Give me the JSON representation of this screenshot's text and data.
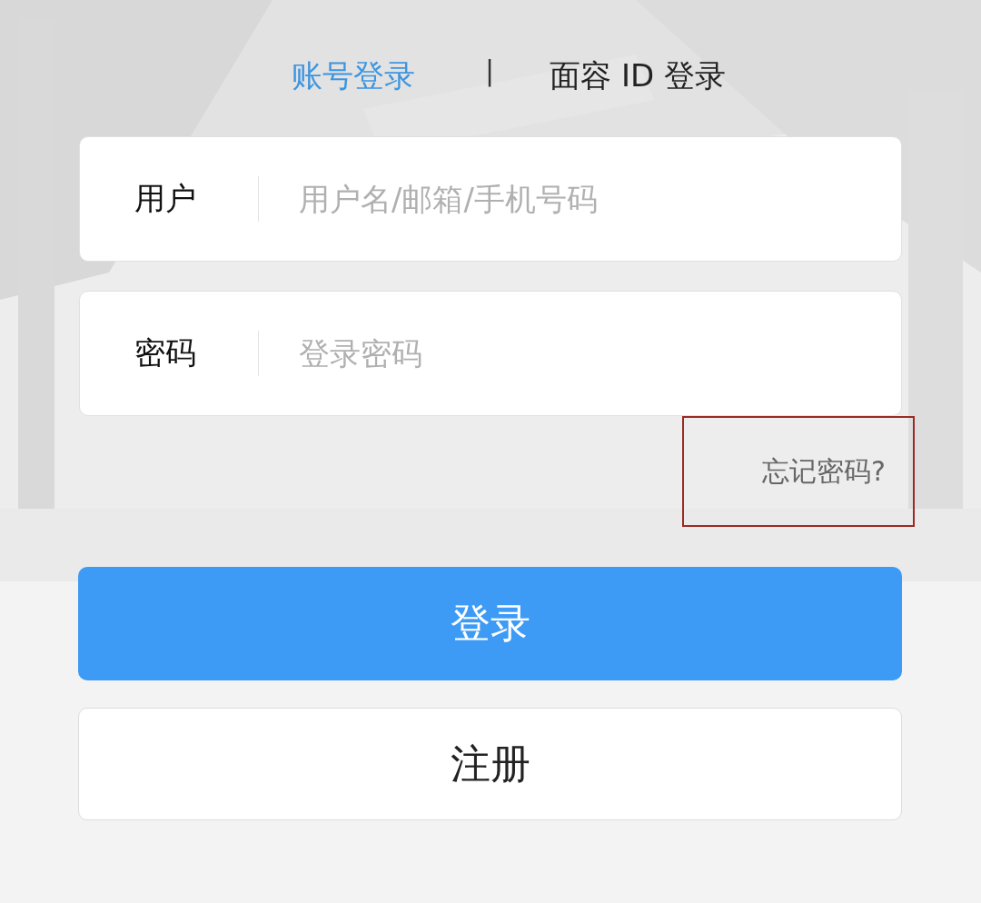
{
  "tabs": [
    {
      "label": "账号登录",
      "selected": true
    },
    {
      "label": "面容 ID 登录",
      "selected": false
    }
  ],
  "tab_separator": "|",
  "fields": [
    {
      "label": "用户",
      "placeholder": "用户名/邮箱/手机号码"
    },
    {
      "label": "密码",
      "placeholder": "登录密码"
    }
  ],
  "forgot_link": {
    "text": "忘记密码?",
    "highlighted": true
  },
  "buttons": [
    {
      "label": "登录",
      "kind": "primary"
    },
    {
      "label": "注册",
      "kind": "secondary"
    }
  ]
}
